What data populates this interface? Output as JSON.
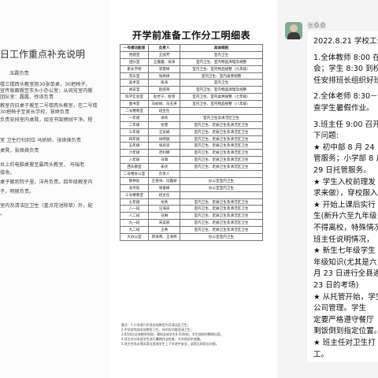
{
  "left": {
    "title": "日工作重点补充说明",
    "lines": [
      "玉霞负责",
      "楼三楼西头教室抱30张单桌，30把椅子。",
      "宣传版面搬至东头小办公室；从阅览室内搬",
      "团队室：露露、徐泽负责",
      "教室内旧桌子搬至二号楼西头教室，在二号楼",
      "30把椅子至家长学校，慧婷负责",
      "负责安排室内桌凳，阅览书架擦拭干净。程",
      "室  卫生打扫到位 马娇娇、张焕焕负责",
      "桌凳，张焕焕负责",
      "台上的电脑桌搬至最西头教室，   马瑞老",
      "接收。",
      "桌子搬到院子里，洋舟负责。四年级教室内",
      "子，明丽负责。",
      "室内及清洁区卫生（重点花池除草）外，配",
      "。"
    ]
  },
  "doc": {
    "title": "开学前准备工作分工明细表",
    "headers": [
      "一号楼功能室",
      "负责人",
      "具体细则"
    ],
    "rows": [
      [
        "党建室",
        "王丽芳",
        "室内卫生"
      ],
      [
        "团队室",
        "王露露、徐泽",
        "室内卫生、室内物品清理及规整"
      ],
      [
        "家长学校",
        "李慧婷",
        "室内卫生、室内物品规整（九年级）"
      ],
      [
        "音乐室",
        "张焕焕",
        "室内卫生、室内桌凳规整"
      ],
      [
        "美术室",
        "张涛",
        "室内卫生"
      ],
      [
        "阅览室",
        "赵丽英",
        "室内卫生、室内物品清理及规整"
      ],
      [
        "科学实验室",
        "赵世宁、程雪",
        "室内卫生、室内桌凳规整（七年级）"
      ],
      [
        "图书室",
        "马娇娇、马玉英",
        "室内卫生、室内物品规整（八年级）"
      ],
      [
        "二号楼教室",
        "班主任",
        ""
      ],
      [
        "一年级",
        "洋舟",
        "室内卫生及清洁区卫生"
      ],
      [
        "二年级",
        "张慧",
        "室内卫生、走廊卫生及清洁区卫生"
      ],
      [
        "三年级",
        "王双娟",
        "室内卫生、走廊卫生及清洁区卫生"
      ],
      [
        "四年级",
        "徐明丽",
        "室内卫生、走廊卫生及清洁区卫生"
      ],
      [
        "五年级",
        "张思思",
        "室内卫生、走廊卫生及清洁区卫生"
      ],
      [
        "六年级",
        "范利攀",
        "室内卫生、走廊卫生及清洁区卫生"
      ],
      [
        "八年级",
        "马瑞",
        "室内卫生、走廊卫生及清洁区卫生"
      ],
      [
        "西头教室",
        "朱伏",
        "室内卫生、走廊卫生及清洁区卫生"
      ],
      [
        "二号楼办公室",
        "负责人",
        ""
      ],
      [
        "教导处",
        "王德涛、冯露娇",
        "办公室室内卫生"
      ],
      [
        "总务处",
        "张俊峰",
        "办公室室内卫生"
      ],
      [
        "三号楼教室",
        "班主任",
        ""
      ],
      [
        "七年级",
        "龙英",
        "室内卫生、走廊卫生及清洁区卫生"
      ],
      [
        "八一班",
        "汪海庆",
        "室内卫生、走廊卫生及清洁区卫生"
      ],
      [
        "八二班",
        "马琳",
        "室内卫生、走廊卫生及清洁区卫生"
      ],
      [
        "九一班",
        "宋美丽",
        "室内卫生、走廊卫生及清洁区卫生"
      ],
      [
        "九二班",
        "王秀",
        "室内卫生、走廊卫生及清洁区卫生"
      ],
      [
        "大办公室",
        "郭海青、王海燕",
        "办公室室内卫生"
      ]
    ],
    "notes": [
      "备注：1.小学部只负责本班教室内及清洁区卫生；",
      "2.中学部完成本班教室卫生，如对应功能室请卫生；",
      "3.8月8点全体教师到岗，通知全体学生8:30到校，学生按校时整理仪容。",
      "4.班主任对本班学生进行暑期作业检查，开学前初步收缴，",
      "5.班主任务必落实家长签收学生上下学途中安全，返家后和家长对接。"
    ]
  },
  "chat": {
    "sender": "张桑桑",
    "lines": [
      "2022.8.21 学校工作",
      "",
      "1.全体教师 8:00 在",
      "会；学生 8:30 到校",
      "任安排班长组织好班",
      "",
      "2.全体老师 8:30－",
      "查学生暑假作业。",
      "",
      "3.班主任 9:00 召开",
      "下问题:",
      "★ 初中部 8 月 24 日",
      "管服务；小学部 8 月",
      "29 日托管服务。",
      "★ 学生入校前理发",
      "求来做），穿校服入",
      "★ 开始上课后实行",
      "生(新升六至九年级",
      "不得离校，特殊情况",
      "班主任说明情况，",
      "★ 新生七年级学生",
      "年级知识(尤其是六",
      "月 23 日进行全县通",
      "23 日的考场)",
      "★ 从托管开始，学生",
      "公司管理。学生",
      "定要严格遵守餐厅",
      "剩饭倒到指定位置。",
      "★ 班主任对卫生打",
      "工。"
    ]
  }
}
